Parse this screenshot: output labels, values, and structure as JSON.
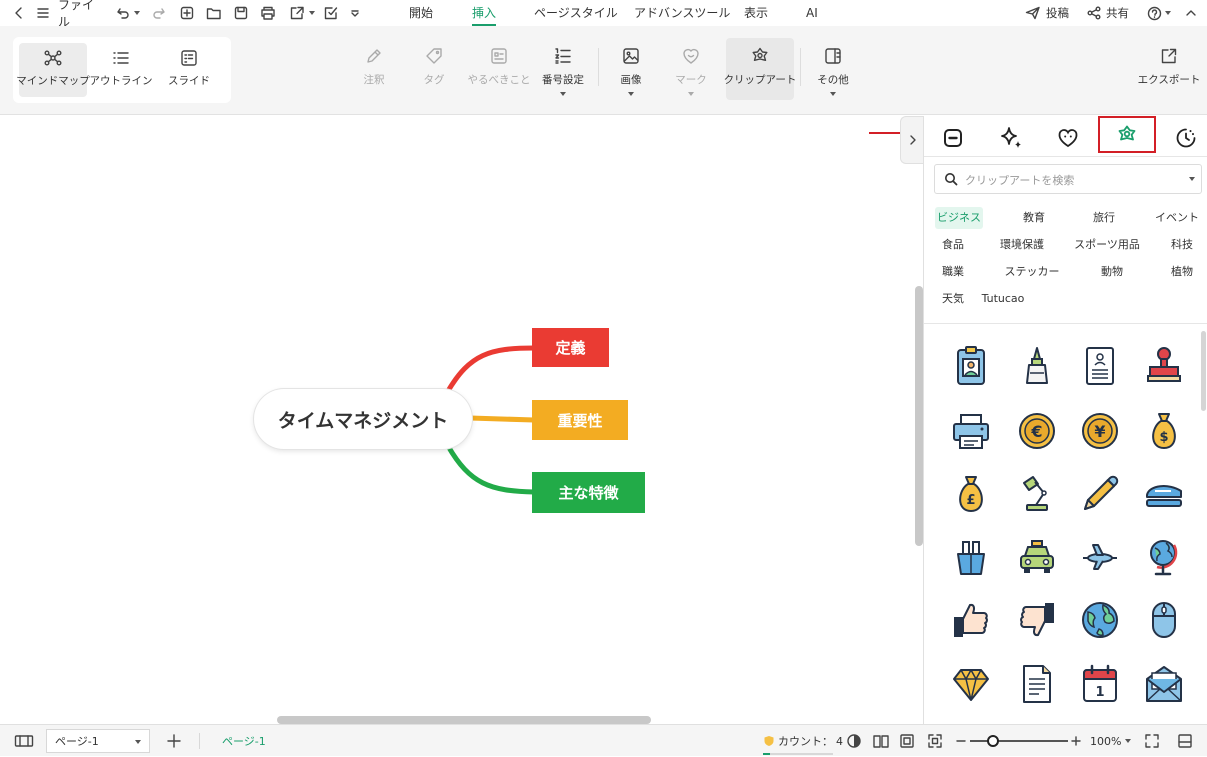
{
  "topbar": {
    "file_label": "ファイル",
    "menu_tabs": [
      "開始",
      "挿入",
      "ページスタイル",
      "アドバンスツール",
      "表示",
      "AI"
    ],
    "active_tab": "挿入",
    "post_label": "投稿",
    "share_label": "共有"
  },
  "toolbar": {
    "view_modes": [
      "マインドマップ",
      "アウトライン",
      "スライド"
    ],
    "tools": {
      "annotation": "注釈",
      "tag": "タグ",
      "todo": "やるべきこと",
      "numbering": "番号設定",
      "image": "画像",
      "mark": "マーク",
      "clipart": "クリップアート",
      "other": "その他"
    },
    "export_label": "エクスポート"
  },
  "mindmap": {
    "central_topic": "タイムマネジメント",
    "branches": [
      {
        "label": "定義",
        "color": "#ea3b33"
      },
      {
        "label": "重要性",
        "color": "#f3ac22"
      },
      {
        "label": "主な特徴",
        "color": "#22ab48"
      }
    ]
  },
  "panel": {
    "search_placeholder": "クリップアートを検索",
    "categories": [
      "ビジネス",
      "教育",
      "旅行",
      "イベント",
      "食品",
      "環境保護",
      "スポーツ用品",
      "科技",
      "職業",
      "ステッカー",
      "動物",
      "植物",
      "天気",
      "Tutucao"
    ],
    "selected_category": "ビジネス",
    "highlight_color": "#d31f26",
    "accent_color": "#1a9e6c",
    "calendar_day": "1",
    "cliparts": [
      "id-badge-icon",
      "glue-bottle-icon",
      "resume-document-icon",
      "rubber-stamp-icon",
      "printer-icon",
      "euro-coin-icon",
      "yen-coin-icon",
      "dollar-money-bag-icon",
      "pound-money-bag-icon",
      "desk-lamp-icon",
      "pencil-icon",
      "stapler-icon",
      "binder-clip-icon",
      "taxi-icon",
      "airplane-icon",
      "globe-stand-icon",
      "thumbs-up-icon",
      "thumbs-down-icon",
      "earth-icon",
      "computer-mouse-icon",
      "diamond-icon",
      "document-icon",
      "calendar-icon",
      "envelope-icon"
    ]
  },
  "statusbar": {
    "page_select": "ページ-1",
    "page_tab": "ページ-1",
    "count_label": "カウント：",
    "count_value": "4",
    "zoom": "100%"
  }
}
